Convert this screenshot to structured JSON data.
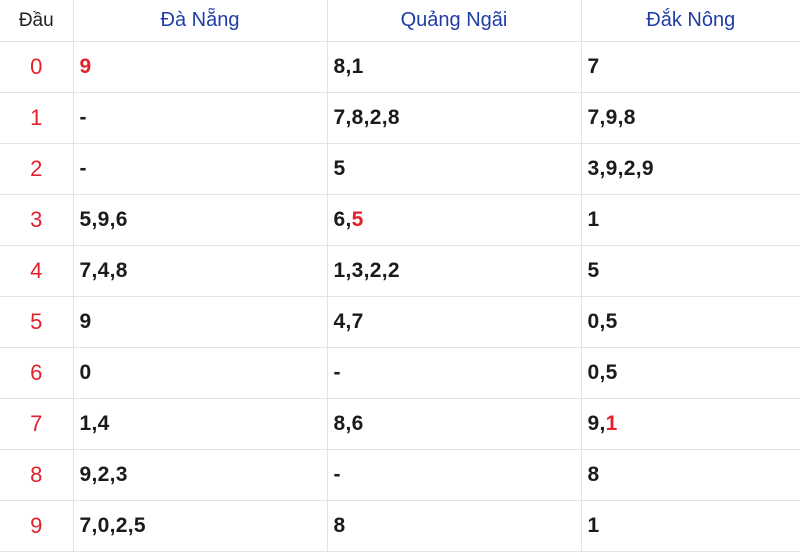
{
  "columns": {
    "head": "Đầu",
    "provinces": [
      "Đà Nẵng",
      "Quảng Ngãi",
      "Đắk Nông"
    ]
  },
  "colors": {
    "header_text": "#1f3da8",
    "highlight": "#e3202b",
    "value_text": "#1b1b1b"
  },
  "rows": [
    {
      "dau": "0",
      "cells": [
        [
          {
            "n": "9",
            "hl": true
          }
        ],
        [
          {
            "n": "8"
          },
          {
            "n": "1"
          }
        ],
        [
          {
            "n": "7"
          }
        ]
      ]
    },
    {
      "dau": "1",
      "cells": [
        [
          {
            "n": "-"
          }
        ],
        [
          {
            "n": "7"
          },
          {
            "n": "8"
          },
          {
            "n": "2"
          },
          {
            "n": "8"
          }
        ],
        [
          {
            "n": "7"
          },
          {
            "n": "9"
          },
          {
            "n": "8"
          }
        ]
      ]
    },
    {
      "dau": "2",
      "cells": [
        [
          {
            "n": "-"
          }
        ],
        [
          {
            "n": "5"
          }
        ],
        [
          {
            "n": "3"
          },
          {
            "n": "9"
          },
          {
            "n": "2"
          },
          {
            "n": "9"
          }
        ]
      ]
    },
    {
      "dau": "3",
      "cells": [
        [
          {
            "n": "5"
          },
          {
            "n": "9"
          },
          {
            "n": "6"
          }
        ],
        [
          {
            "n": "6"
          },
          {
            "n": "5",
            "hl": true
          }
        ],
        [
          {
            "n": "1"
          }
        ]
      ]
    },
    {
      "dau": "4",
      "cells": [
        [
          {
            "n": "7"
          },
          {
            "n": "4"
          },
          {
            "n": "8"
          }
        ],
        [
          {
            "n": "1"
          },
          {
            "n": "3"
          },
          {
            "n": "2"
          },
          {
            "n": "2"
          }
        ],
        [
          {
            "n": "5"
          }
        ]
      ]
    },
    {
      "dau": "5",
      "cells": [
        [
          {
            "n": "9"
          }
        ],
        [
          {
            "n": "4"
          },
          {
            "n": "7"
          }
        ],
        [
          {
            "n": "0"
          },
          {
            "n": "5"
          }
        ]
      ]
    },
    {
      "dau": "6",
      "cells": [
        [
          {
            "n": "0"
          }
        ],
        [
          {
            "n": "-"
          }
        ],
        [
          {
            "n": "0"
          },
          {
            "n": "5"
          }
        ]
      ]
    },
    {
      "dau": "7",
      "cells": [
        [
          {
            "n": "1"
          },
          {
            "n": "4"
          }
        ],
        [
          {
            "n": "8"
          },
          {
            "n": "6"
          }
        ],
        [
          {
            "n": "9"
          },
          {
            "n": "1",
            "hl": true
          }
        ]
      ]
    },
    {
      "dau": "8",
      "cells": [
        [
          {
            "n": "9"
          },
          {
            "n": "2"
          },
          {
            "n": "3"
          }
        ],
        [
          {
            "n": "-"
          }
        ],
        [
          {
            "n": "8"
          }
        ]
      ]
    },
    {
      "dau": "9",
      "cells": [
        [
          {
            "n": "7"
          },
          {
            "n": "0"
          },
          {
            "n": "2"
          },
          {
            "n": "5"
          }
        ],
        [
          {
            "n": "8"
          }
        ],
        [
          {
            "n": "1"
          }
        ]
      ]
    }
  ]
}
